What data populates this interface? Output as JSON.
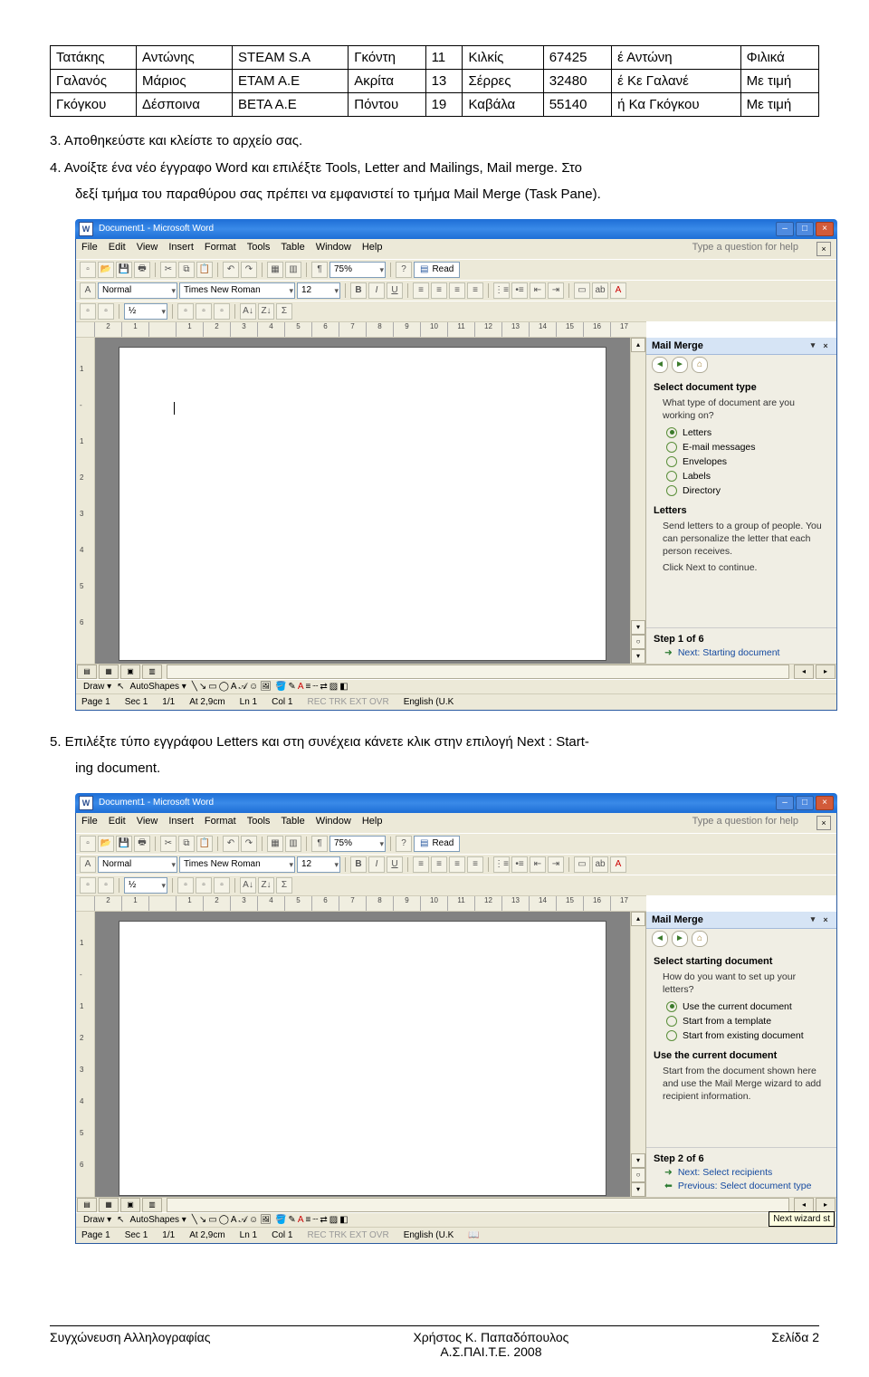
{
  "table": {
    "rows": [
      [
        "Τατάκης",
        "Αντώνης",
        "STEAM S.A",
        "Γκόντη",
        "11",
        "Κιλκίς",
        "67425",
        "έ Αντώνη",
        "Φιλικά"
      ],
      [
        "Γαλανός",
        "Μάριος",
        "ETAM A.E",
        "Ακρίτα",
        "13",
        "Σέρρες",
        "32480",
        "έ Κε Γαλανέ",
        "Με τιμή"
      ],
      [
        "Γκόγκου",
        "Δέσποινα",
        "BETA A.E",
        "Πόντου",
        "19",
        "Καβάλα",
        "55140",
        "ή Κα Γκόγκου",
        "Με τιμή"
      ]
    ]
  },
  "body": {
    "p3": "3.  Αποθηκεύστε και κλείστε το αρχείο σας.",
    "p4a": "4.  Ανοίξτε ένα νέο έγγραφο Word και επιλέξτε Tools, Letter and Mailings, Mail merge. Στο",
    "p4b": "δεξί τμήμα του παραθύρου σας πρέπει να εμφανιστεί το τμήμα Mail Merge (Task Pane).",
    "p5a": "5.  Επιλέξτε τύπο εγγράφου Letters και στη συνέχεια κάνετε κλικ στην επιλογή Next : Start-",
    "p5b": "ing document."
  },
  "word": {
    "title": "Document1 - Microsoft Word",
    "menus": [
      "File",
      "Edit",
      "View",
      "Insert",
      "Format",
      "Tools",
      "Table",
      "Window",
      "Help"
    ],
    "help_hint": "Type a question for help",
    "style_normal": "Normal",
    "font": "Times New Roman",
    "size": "12",
    "zoom": "75%",
    "read": "Read",
    "ruler_marks": [
      "2",
      "1",
      "",
      "1",
      "2",
      "3",
      "4",
      "5",
      "6",
      "7",
      "8",
      "9",
      "10",
      "11",
      "12",
      "13",
      "14",
      "15",
      "16",
      "17"
    ],
    "draw_label": "Draw ▾",
    "autoshapes": "AutoShapes ▾",
    "status": {
      "page": "Page 1",
      "sec": "Sec 1",
      "of": "1/1",
      "at": "At  2,9cm",
      "ln": "Ln 1",
      "col": "Col 1",
      "modes": "REC  TRK  EXT  OVR",
      "lang": "English (U.K"
    }
  },
  "pane1": {
    "title": "Mail Merge",
    "sec": "Select document type",
    "q": "What type of document are you working on?",
    "opts": [
      "Letters",
      "E-mail messages",
      "Envelopes",
      "Labels",
      "Directory"
    ],
    "sub_t": "Letters",
    "sub_txt": "Send letters to a group of people. You can personalize the letter that each person receives.",
    "sub_next": "Click Next to continue.",
    "step": "Step 1 of 6",
    "next": "Next: Starting document"
  },
  "pane2": {
    "title": "Mail Merge",
    "sec": "Select starting document",
    "q": "How do you want to set up your letters?",
    "opts": [
      "Use the current document",
      "Start from a template",
      "Start from existing document"
    ],
    "sub_t": "Use the current document",
    "sub_txt": "Start from the document shown here and use the Mail Merge wizard to add recipient information.",
    "step": "Step 2 of 6",
    "next": "Next: Select recipients",
    "prev": "Previous: Select document type",
    "tooltip": "Next wizard st"
  },
  "footer": {
    "left": "Συγχώνευση Αλληλογραφίας",
    "c1": "Χρήστος Κ. Παπαδόπουλος",
    "c2": "Α.Σ.ΠΑΙ.Τ.Ε. 2008",
    "right": "Σελίδα 2"
  }
}
